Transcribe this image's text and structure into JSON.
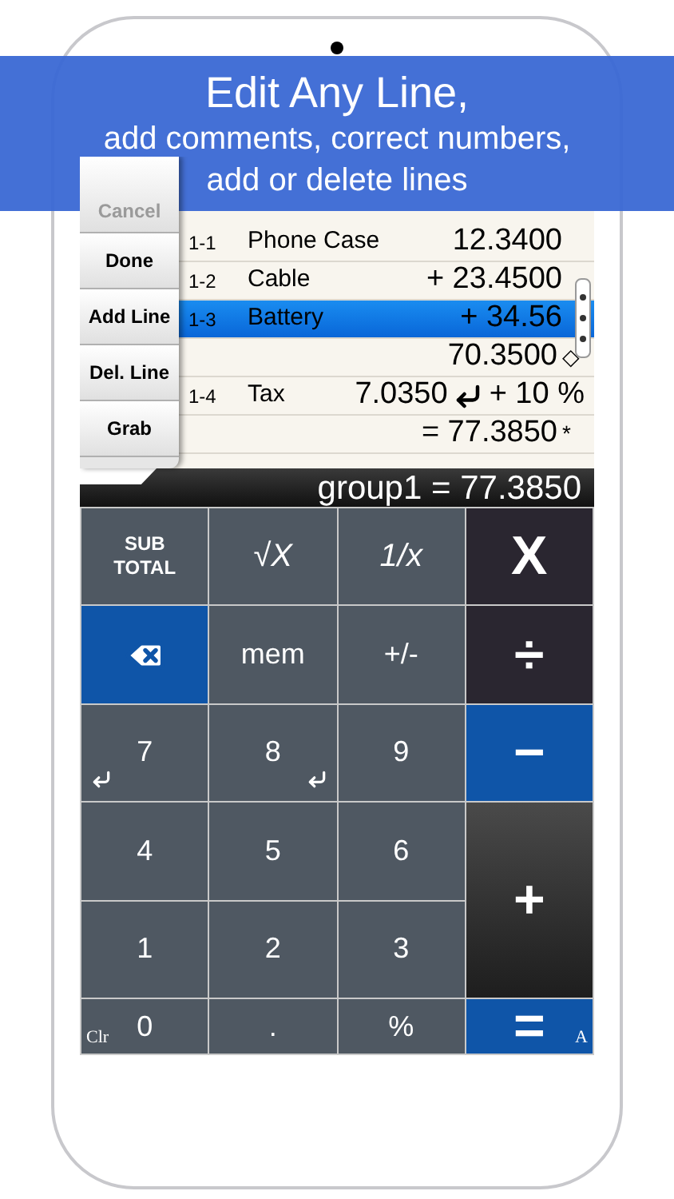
{
  "banner": {
    "title": "Edit Any Line,",
    "subtitle": "add comments, correct numbers,\nadd or delete lines"
  },
  "side_buttons": [
    {
      "label": "Cancel"
    },
    {
      "label": "Done"
    },
    {
      "label": "Add Line"
    },
    {
      "label": "Del. Line"
    },
    {
      "label": "Grab"
    }
  ],
  "lines": [
    {
      "kind": "item",
      "id": "1-1",
      "name": "Phone Case",
      "value": "12.3400",
      "selected": false
    },
    {
      "kind": "item",
      "id": "1-2",
      "name": "Cable",
      "value": "+ 23.4500",
      "selected": false
    },
    {
      "kind": "item",
      "id": "1-3",
      "name": "Battery",
      "value": "+ 34.56",
      "selected": true
    },
    {
      "kind": "subtotal",
      "value": "70.3500",
      "mark": "◇"
    },
    {
      "kind": "percent",
      "id": "1-4",
      "name": "Tax",
      "value": "7.0350",
      "operation": "+ 10 %"
    },
    {
      "kind": "subtotal",
      "value": "= 77.3850",
      "mark": "*"
    }
  ],
  "result": "group1 = 77.3850",
  "keys": [
    {
      "label": "SUB TOTAL",
      "kind": "subtotal"
    },
    {
      "label": "√X",
      "kind": "function"
    },
    {
      "label": "1/x",
      "kind": "function"
    },
    {
      "label": "X",
      "kind": "operator"
    },
    {
      "kind": "backspace"
    },
    {
      "label": "mem",
      "kind": "digit"
    },
    {
      "label": "+/-",
      "kind": "digit"
    },
    {
      "label": "÷",
      "kind": "operator"
    },
    {
      "label": "7",
      "kind": "return"
    },
    {
      "label": "8",
      "kind": "hook"
    },
    {
      "label": "9",
      "kind": "digit"
    },
    {
      "label": "−",
      "kind": "minus"
    },
    {
      "label": "4",
      "kind": "digit"
    },
    {
      "label": "5",
      "kind": "digit"
    },
    {
      "label": "6",
      "kind": "digit"
    },
    {
      "label": "+",
      "kind": "plus"
    },
    {
      "label": "1",
      "kind": "digit"
    },
    {
      "label": "2",
      "kind": "digit"
    },
    {
      "label": "3",
      "kind": "digit"
    },
    {
      "label": "0",
      "kind": "digit",
      "hint": "Clr"
    },
    {
      "label": ".",
      "kind": "digit"
    },
    {
      "label": "%",
      "kind": "digit"
    },
    {
      "label": "=",
      "kind": "equals",
      "hint": "A"
    }
  ]
}
